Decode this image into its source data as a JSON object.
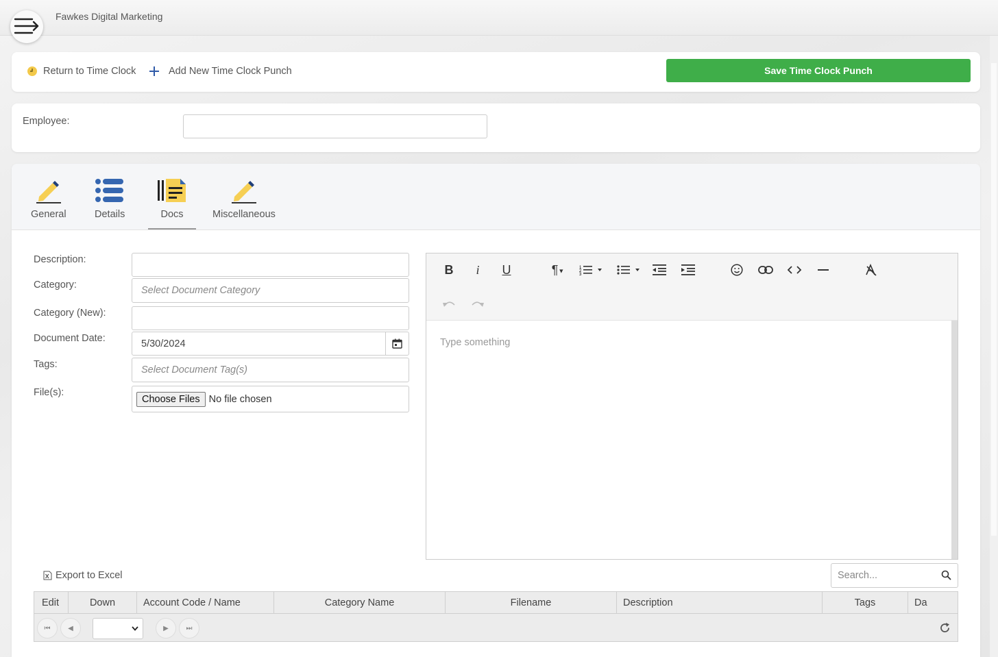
{
  "header": {
    "company_name": "Fawkes Digital Marketing",
    "menu_icon": "hamburger-arrow-icon"
  },
  "actions": {
    "return_label": "Return to Time Clock",
    "add_label": "Add New Time Clock Punch",
    "save_label": "Save Time Clock Punch",
    "save_color": "#3fae49"
  },
  "employee": {
    "label": "Employee:",
    "value": ""
  },
  "tabs": [
    {
      "label": "General",
      "icon": "pencil-icon",
      "active": false
    },
    {
      "label": "Details",
      "icon": "list-icon",
      "active": false
    },
    {
      "label": "Docs",
      "icon": "document-icon",
      "active": true
    },
    {
      "label": "Miscellaneous",
      "icon": "pencil-icon",
      "active": false
    }
  ],
  "form": {
    "description_label": "Description:",
    "description_value": "",
    "category_label": "Category:",
    "category_placeholder": "Select Document Category",
    "category_new_label": "Category (New):",
    "category_new_value": "",
    "date_label": "Document Date:",
    "date_value": "5/30/2024",
    "tags_label": "Tags:",
    "tags_placeholder": "Select Document Tag(s)",
    "files_label": "File(s):",
    "choose_files_label": "Choose Files",
    "no_file_text": "No file chosen"
  },
  "editor": {
    "placeholder": "Type something",
    "toolbar": [
      "bold",
      "italic",
      "underline",
      "paragraph",
      "ordered-list",
      "unordered-list",
      "outdent",
      "indent",
      "emoji",
      "link",
      "code",
      "horizontal-rule",
      "clear-format",
      "undo",
      "redo"
    ]
  },
  "grid": {
    "export_label": "Export to Excel",
    "search_placeholder": "Search...",
    "columns": [
      "Edit",
      "Down",
      "Account Code / Name",
      "Category Name",
      "Filename",
      "Description",
      "Tags",
      "Da"
    ]
  }
}
